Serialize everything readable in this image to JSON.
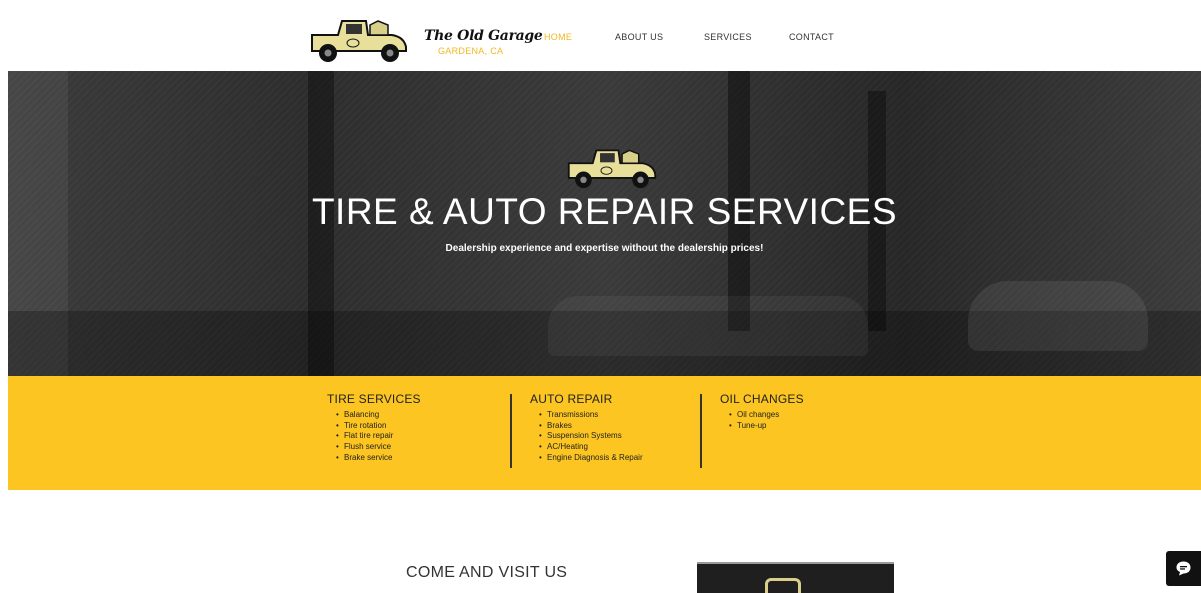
{
  "header": {
    "brand_name": "The Old Garage",
    "brand_location": "GARDENA, CA",
    "nav": [
      {
        "label": "HOME",
        "active": true
      },
      {
        "label": "ABOUT US",
        "active": false
      },
      {
        "label": "SERVICES",
        "active": false
      },
      {
        "label": "CONTACT",
        "active": false
      }
    ]
  },
  "hero": {
    "title": "TIRE & AUTO REPAIR SERVICES",
    "subtitle": "Dealership experience and expertise without the dealership prices!"
  },
  "services": [
    {
      "heading": "TIRE SERVICES",
      "items": [
        "Balancing",
        "Tire rotation",
        "Flat tire repair",
        "Flush service",
        "Brake service"
      ]
    },
    {
      "heading": "AUTO REPAIR",
      "items": [
        "Transmissions",
        "Brakes",
        "Suspension Systems",
        "AC/Heating",
        "Engine Diagnosis & Repair"
      ]
    },
    {
      "heading": "OIL CHANGES",
      "items": [
        "Oil changes",
        "Tune-up"
      ]
    }
  ],
  "visit": {
    "title": "COME AND VISIT US"
  },
  "colors": {
    "accent": "#fcc521",
    "nav_active": "#f2b820",
    "hero_bg": "#2f2f2f"
  },
  "icons": {
    "logo": "pickup-truck-icon",
    "chat": "chat-bubble-icon"
  }
}
